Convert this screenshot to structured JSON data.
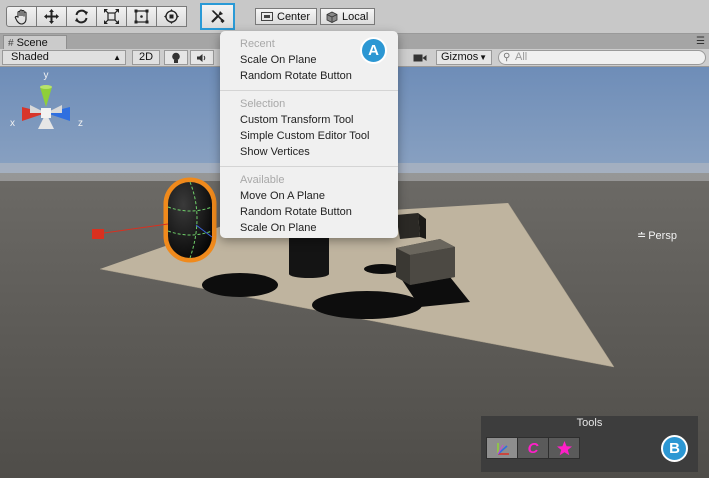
{
  "toolbar": {
    "tools": [
      {
        "name": "hand-tool-button",
        "icon": "hand-icon"
      },
      {
        "name": "move-tool-button",
        "icon": "move-arrows-icon"
      },
      {
        "name": "rotate-tool-button",
        "icon": "rotate-icon"
      },
      {
        "name": "scale-tool-button",
        "icon": "scale-icon"
      },
      {
        "name": "rect-tool-button",
        "icon": "rect-transform-icon"
      },
      {
        "name": "transform-tool-button",
        "icon": "transform-icon"
      }
    ],
    "custom_tool_icon": "custom-tools-icon",
    "pivot_label": "Center",
    "space_label": "Local"
  },
  "tab": {
    "label": "Scene"
  },
  "scene_controls": {
    "shading_label": "Shaded",
    "mode_2d_label": "2D",
    "gizmos_label": "Gizmos",
    "search_placeholder": "All"
  },
  "gizmo": {
    "axis_y": "y",
    "axis_x": "x",
    "axis_z": "z",
    "projection_label": "Persp"
  },
  "menu": {
    "sections": [
      {
        "header": "Recent",
        "items": [
          "Scale On Plane",
          "Random Rotate Button"
        ]
      },
      {
        "header": "Selection",
        "items": [
          "Custom Transform Tool",
          "Simple Custom Editor Tool",
          "Show Vertices"
        ]
      },
      {
        "header": "Available",
        "items": [
          "Move On A Plane",
          "Random Rotate Button",
          "Scale On Plane"
        ]
      }
    ]
  },
  "callouts": {
    "a": "A",
    "b": "B"
  },
  "tools_overlay": {
    "title": "Tools",
    "buttons": [
      "axes-tool-icon",
      "c-tool-icon",
      "star-tool-icon"
    ],
    "c_label": "C"
  },
  "colors": {
    "accent": "#2a9ad6",
    "badge": "#2c97d3",
    "selection_outline": "#f08a1c",
    "axis_x": "#d8352a",
    "axis_y": "#8fcf3a",
    "axis_z": "#2f6fe0",
    "magenta": "#ff1fc8"
  }
}
